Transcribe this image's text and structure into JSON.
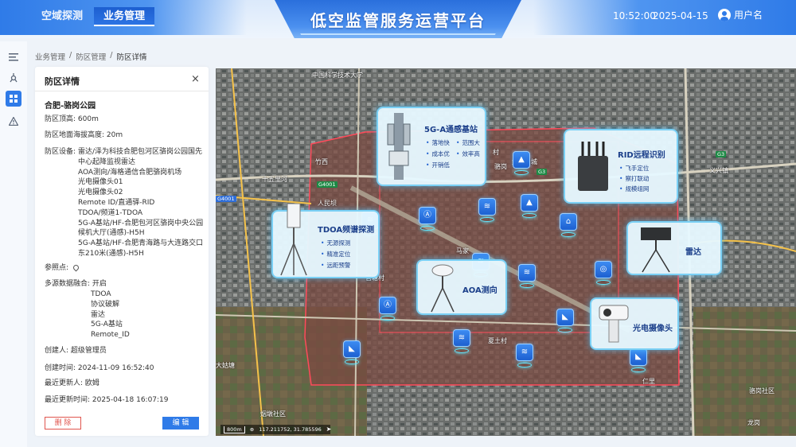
{
  "header": {
    "nav": [
      "空域探测",
      "业务管理"
    ],
    "title": "低空监管服务运营平台",
    "time": "10:52:00",
    "date": "2025-04-15",
    "user": "用户名"
  },
  "breadcrumb": [
    "业务管理",
    "防区管理",
    "防区详情"
  ],
  "panel": {
    "title": "防区详情",
    "close_icon": "×",
    "zone_name": "合肥-骆岗公园",
    "top_label": "防区顶高:",
    "top_value": "600m",
    "altitude_label": "防区地面海拔高度:",
    "altitude_value": "20m",
    "devices_label": "防区设备:",
    "devices": [
      "雷达/泽为科技合肥包河区骆岗公园国先",
      "中心起降监视雷达",
      "AOA测向/海格通信合肥骆岗机场",
      "光电摄像头01",
      "光电摄像头02",
      "Remote ID/直通驿-RID",
      "TDOA/频道1-TDOA",
      "5G-A基站/HF-合肥包河区骆岗中央公园",
      "候机大厅(通感)-H5H",
      "5G-A基站/HF-合肥青海路与大连路交口",
      "东210米(通感)-H5H"
    ],
    "ref_label": "参照点:",
    "fusion_label": "多源数据融合:",
    "fusion_status": "开启",
    "fusion_items": [
      "TDOA",
      "协议破解",
      "雷达",
      "5G-A基站",
      "Remote_ID"
    ],
    "creator_label": "创建人:",
    "creator": "超级管理员",
    "created_label": "创建时间:",
    "created": "2024-11-09 16:52:40",
    "updater_label": "最近更新人:",
    "updater": "欧姆",
    "updated_label": "最近更新时间:",
    "updated": "2025-04-18 16:07:19",
    "delete_btn": "删 除",
    "edit_btn": "编 辑"
  },
  "map": {
    "labels": [
      "中国科学技术大学",
      "竹西",
      "十五里河",
      "人民坝",
      "村",
      "骆岗",
      "马家",
      "官塘村",
      "叶家",
      "夏土村",
      "大姑塘",
      "烟墩社区",
      "大湖名城",
      "义兴镇",
      "骆岗社区",
      "龙岗",
      "仁里",
      "G4001",
      "G3",
      "G3",
      "G4001"
    ],
    "scale": "800m",
    "coords": "117.211752, 31.785596",
    "callouts": {
      "base_station": {
        "title": "5G-A通感基站",
        "items": [
          "落地快",
          "范围大",
          "成本优",
          "效率高",
          "开销低"
        ]
      },
      "rid": {
        "title": "RID远程识别",
        "items": [
          "飞手定位",
          "察打联动",
          "规模组网"
        ]
      },
      "tdoa": {
        "title": "TDOA频谱探测",
        "items": [
          "无源探测",
          "精准定位",
          "远距预警"
        ]
      },
      "aoa": {
        "title": "AOA测向"
      },
      "radar": {
        "title": "雷达"
      },
      "eo": {
        "title": "光电摄像头"
      }
    }
  }
}
